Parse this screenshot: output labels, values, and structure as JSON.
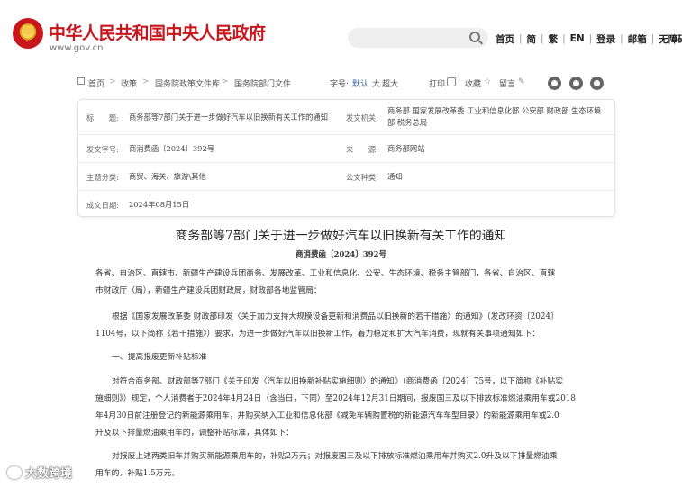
{
  "header": {
    "site_title": "中华人民共和国中央人民政府",
    "site_url": "www.gov.cn",
    "search_placeholder": "",
    "nav": [
      "首页",
      "简",
      "繁",
      "EN",
      "登录",
      "邮箱",
      "无障碍"
    ]
  },
  "breadcrumb": {
    "items": [
      "首页",
      "政策",
      "国务院政策文件库",
      "国务院部门文件"
    ],
    "font_size_label": "字号:",
    "font_default": "默认",
    "font_large": "大",
    "font_xlarge": "超大",
    "print": "打印",
    "favorite": "收藏",
    "message": "留言"
  },
  "meta": {
    "title_label": "标　　题:",
    "title_value": "商务部等7部门关于进一步做好汽车以旧换新有关工作的通知",
    "issuer_label": "发文机关:",
    "issuer_value": "商务部 国家发展改革委 工业和信息化部 公安部 财政部 生态环境部 税务总局",
    "docno_label": "发文字号:",
    "docno_value": "商消费函〔2024〕392号",
    "source_label": "来　　源:",
    "source_value": "商务部网站",
    "topic_label": "主题分类:",
    "topic_value": "商贸、海关、旅游\\其他",
    "type_label": "公文种类:",
    "type_value": "通知",
    "date_label": "成文日期:",
    "date_value": "2024年08月15日"
  },
  "document": {
    "title": "商务部等7部门关于进一步做好汽车以旧换新有关工作的通知",
    "number": "商消费函〔2024〕392号",
    "p1_l1": "各省、自治区、直辖市、新疆生产建设兵团商务、发展改革、工业和信息化、公安、生态环境、税务主管部门，各省、自治区、直辖",
    "p1_l2": "市财政厅（局），新疆生产建设兵团财政局，财政部各地监管局：",
    "p2_l1": "根据《国家发展改革委 财政部印发〈关于加力支持大规模设备更新和消费品以旧换新的若干措施〉的通知》（发改环资〔2024〕",
    "p2_l2": "1104号，以下简称《若干措施》）要求，为进一步做好汽车以旧换新工作，着力稳定和扩大汽车消费，现就有关事项通知如下：",
    "section1": "一、提高报废更新补贴标准",
    "p3_l1": "对符合商务部、财政部等7部门《关于印发〈汽车以旧换新补贴实施细则〉的通知》（商消费函〔2024〕75号，以下简称《补贴实",
    "p3_l2": "施细则》）规定，个人消费者于2024年4月24日（含当日，下同）至2024年12月31日期间，报废国三及以下排放标准燃油乘用车或2018",
    "p3_l3": "年4月30日前注册登记的新能源乘用车，并购买纳入工业和信息化部《减免车辆购置税的新能源汽车车型目录》的新能源乘用车或2.0",
    "p3_l4": "升及以下排量燃油乘用车的，调整补贴标准，具体如下：",
    "p4_l1": "对报废上述两类旧车并购买新能源乘用车的，补贴2万元；对报废国三及以下排放标准燃油乘用车并购买2.0升及以下排量燃油乘",
    "p4_l2": "用车的，补贴1.5万元。"
  },
  "watermark": "大数跨境"
}
